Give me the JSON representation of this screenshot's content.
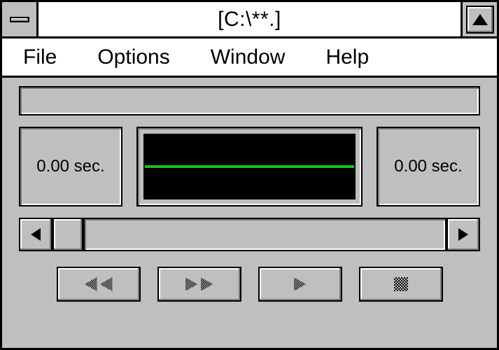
{
  "titlebar": {
    "title": "[C:\\**.]"
  },
  "menu": {
    "file": "File",
    "options": "Options",
    "window": "Window",
    "help": "Help"
  },
  "times": {
    "left": "0.00 sec.",
    "right": "0.00 sec."
  },
  "colors": {
    "waveform_line": "#1bbf1b",
    "waveform_bg": "#000000"
  }
}
